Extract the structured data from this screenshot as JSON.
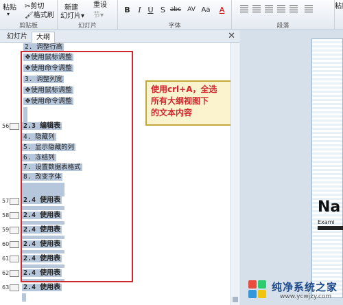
{
  "ribbon": {
    "paste": "粘贴",
    "cut": "剪切",
    "format_painter": "格式刷",
    "new_slide": "新建",
    "new_slide_sub": "幻灯片",
    "reset": "重设",
    "section": "节",
    "clipboard_label": "剪贴板",
    "slides_label": "幻灯片",
    "font_label": "字体",
    "paragraph_label": "段落",
    "format_buttons": [
      "B",
      "I",
      "U",
      "S",
      "abc",
      "AV",
      "Aa",
      "A"
    ],
    "right_btn": "粘贴"
  },
  "panel": {
    "tab_slides": "幻灯片",
    "tab_outline": "大纲",
    "close": "✕"
  },
  "outline_lines": [
    "2. 调整行高",
    "❖使用鼠标调整",
    "❖使用命令调整",
    "3. 调整列宽",
    "❖使用鼠标调整",
    "❖使用命令调整",
    "2.3 编辑表",
    "4. 隐藏列",
    "5. 显示隐藏的列",
    "6. 冻结列",
    "7. 设置数据表格式",
    "8. 改变字体",
    "2.4 使用表",
    "2.4 使用表",
    "2.4 使用表",
    "2.4 使用表",
    "2.4 使用表",
    "2.4 使用表",
    "2.4 使用表"
  ],
  "slide_numbers": [
    "56",
    "57",
    "58",
    "59",
    "60",
    "61",
    "62",
    "63"
  ],
  "callout": {
    "text1": "使用crl+A，全选",
    "text2": "所有大纲视图下",
    "text3": "的文本内容"
  },
  "preview": {
    "logo": "Na",
    "sub": "Exami"
  },
  "watermark": {
    "title": "纯净系统之家",
    "url": "www.ycwjzy.com"
  },
  "colors": {
    "selection": "#b7c7db",
    "highlight_box": "#d0262e",
    "callout_bg": "#fbf3cd"
  }
}
